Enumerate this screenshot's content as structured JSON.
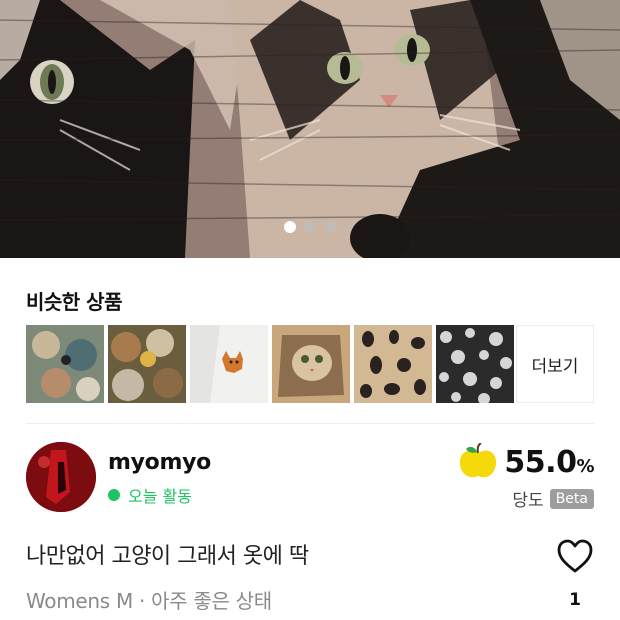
{
  "hero": {
    "image_label": "cat tapestry fabric photo",
    "dots": [
      true,
      false,
      false
    ]
  },
  "similar": {
    "title": "비슷한 상품",
    "more_label": "더보기",
    "thumbs": [
      "floral fabric",
      "vintage floral",
      "cat embroidery",
      "cat photo",
      "insect print",
      "black white print"
    ]
  },
  "seller": {
    "name": "myomyo",
    "activity": "오늘 활동"
  },
  "sweetness": {
    "value": "55.0",
    "unit": "%",
    "label": "당도",
    "badge": "Beta"
  },
  "product": {
    "title": "나만없어 고양이 그래서 옷에 딱",
    "meta": "Womens M · 아주 좋은 상태",
    "like_count": "1"
  },
  "colors": {
    "accent_green": "#1ec463",
    "beta_gray": "#9e9e9e",
    "apple_yellow": "#f5d90a"
  }
}
